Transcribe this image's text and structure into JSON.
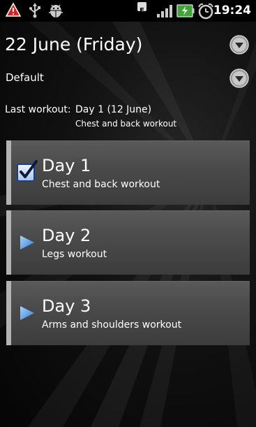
{
  "status_bar": {
    "time": "19:24",
    "icons": [
      "warning-icon",
      "usb-icon",
      "android-debug-icon",
      "edge-data-icon",
      "signal-icon",
      "battery-charging-icon",
      "alarm-icon"
    ],
    "network_letter": "E"
  },
  "header": {
    "date_title": "22 June (Friday)",
    "program": "Default"
  },
  "last_workout": {
    "label": "Last workout:",
    "day": "Day 1 (12 June)",
    "description": "Chest and back workout"
  },
  "days": [
    {
      "name": "Day 1",
      "description": "Chest and back workout",
      "state": "completed",
      "icon": "checkbox-checked-icon"
    },
    {
      "name": "Day 2",
      "description": "Legs workout",
      "state": "pending",
      "icon": "play-arrow-icon"
    },
    {
      "name": "Day 3",
      "description": "Arms and shoulders workout",
      "state": "pending",
      "icon": "play-arrow-icon"
    }
  ],
  "colors": {
    "accent_blue": "#4a90e2",
    "card_bar": "#b3b3b3",
    "battery_green": "#3fa535"
  }
}
